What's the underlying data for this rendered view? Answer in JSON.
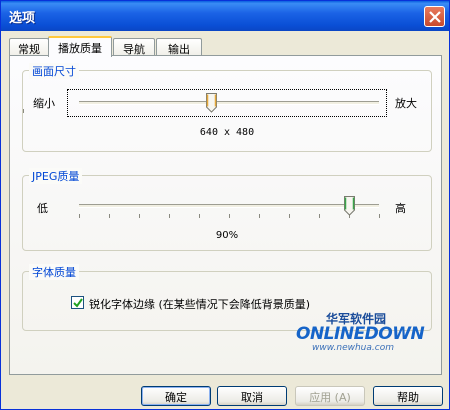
{
  "window": {
    "title": "选项"
  },
  "tabs": [
    {
      "label": "常规",
      "active": false
    },
    {
      "label": "播放质量",
      "active": true
    },
    {
      "label": "导航",
      "active": false
    },
    {
      "label": "输出",
      "active": false
    }
  ],
  "size_group": {
    "label": "画面尺寸",
    "min_label": "缩小",
    "max_label": "放大",
    "value_text": "640 x 480",
    "slider_level": 0.44
  },
  "jpeg_group": {
    "label": "JPEG质量",
    "min_label": "低",
    "max_label": "高",
    "value_text": "90%",
    "slider_level": 0.9
  },
  "font_group": {
    "label": "字体质量",
    "checkbox_label": "锐化字体边缘 (在某些情况下会降低背景质量)",
    "checkbox_checked": true
  },
  "buttons": {
    "ok": "确定",
    "cancel": "取消",
    "apply": "应用 (A)",
    "help": "帮助"
  },
  "watermark": {
    "title": "华军软件园",
    "logo": "ONLINEDOWN",
    "url": "www.newhua.com"
  },
  "colors": {
    "titlebar": "#0a4fd6",
    "group_label": "#0046d5",
    "tab_highlight": "#ffc83c",
    "thumb_size": "#e5a83b",
    "thumb_jpeg": "#3aa44a"
  }
}
